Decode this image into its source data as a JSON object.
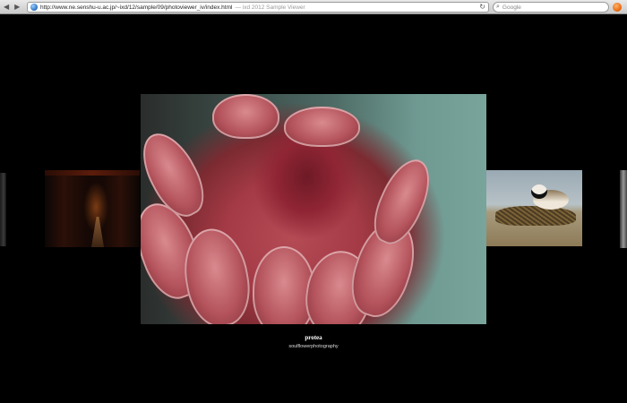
{
  "browser": {
    "url": "http://www.ne.senshu-u.ac.jp/~ixd/12/sample/09/photoviewer_iv/index.html",
    "page_title": "— ixd 2012 Sample Viewer",
    "search_placeholder": "Google"
  },
  "viewer": {
    "current": {
      "title": "protea",
      "author": "soulflowerphotography"
    }
  }
}
